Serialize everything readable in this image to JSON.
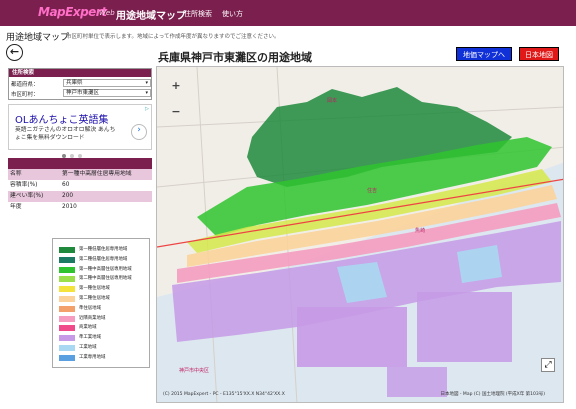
{
  "header": {
    "logo": "MapExpert",
    "logo_sub": "Web",
    "app_title": "用途地域マップ",
    "nav": [
      "住所検索",
      "使い方"
    ],
    "colors": {
      "bar": "#7a1f4e",
      "logo": "#ff6ec7"
    }
  },
  "page": {
    "heading": "用途地域マップ",
    "note": "市区町村単位で表示します。地域によって作成年度が異なりますのでご注意ください。",
    "back_icon": "back-arrow-icon",
    "map_title": "兵庫県神戸市東灘区の用途地域",
    "btn_land_price": "地価マップへ",
    "btn_japan_map": "日本地図"
  },
  "search": {
    "title": "住所検索",
    "pref_label": "都道府県：",
    "pref_value": "兵庫県",
    "city_label": "市区町村：",
    "city_value": "神戸市東灘区"
  },
  "ad": {
    "title": "OLあんちょこ英語集",
    "text": "英語ニガテさんのオロオロ解決 あんちょこ集を無料ダウンロード",
    "button_icon": "chevron-right-icon",
    "badge": "▷"
  },
  "info": {
    "rows": [
      {
        "key": "名称",
        "value": "第一種中高層住居専用地域"
      },
      {
        "key": "容積率(%)",
        "value": "60"
      },
      {
        "key": "建ぺい率(%)",
        "value": "200"
      },
      {
        "key": "年度",
        "value": "2010"
      }
    ]
  },
  "legend": [
    {
      "label": "第一種低層住居専用地域",
      "color": "#1f8a3c"
    },
    {
      "label": "第二種低層住居専用地域",
      "color": "#1d7a63"
    },
    {
      "label": "第一種中高層住居専用地域",
      "color": "#2fc42f"
    },
    {
      "label": "第二種中高層住居専用地域",
      "color": "#9be04a"
    },
    {
      "label": "第一種住居地域",
      "color": "#f3e33a"
    },
    {
      "label": "第二種住居地域",
      "color": "#fbd39a"
    },
    {
      "label": "準住居地域",
      "color": "#f3a06a"
    },
    {
      "label": "近隣商業地域",
      "color": "#f59cc0"
    },
    {
      "label": "商業地域",
      "color": "#f04a8a"
    },
    {
      "label": "準工業地域",
      "color": "#c69ae6"
    },
    {
      "label": "工業地域",
      "color": "#a9d9f2"
    },
    {
      "label": "工業専用地域",
      "color": "#5aa0e0"
    }
  ],
  "map": {
    "copyright": "(C) 2015 MapExpert - PC - E135°15'XX.X N34°42'XX.X",
    "attribution": "日本地図 - Map (C) 国土地理院 (平成X年 第103号)",
    "places": [
      "神戸市中央区",
      "岡本",
      "魚崎",
      "住吉"
    ],
    "zoom_in": "+",
    "zoom_out": "−",
    "fullscreen_icon": "fullscreen-icon"
  }
}
